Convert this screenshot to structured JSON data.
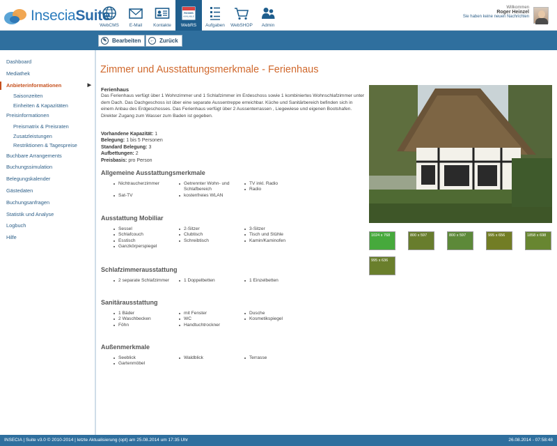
{
  "app": {
    "logo_text_light": "Insecia",
    "logo_text_bold": "Suite"
  },
  "nav": [
    {
      "label": "WebCMS",
      "icon": "globe-icon"
    },
    {
      "label": "E-Mail",
      "icon": "envelope-icon"
    },
    {
      "label": "Kontakte",
      "icon": "contact-card-icon"
    },
    {
      "label": "WebRS",
      "icon": "rooms-available-icon",
      "active": true
    },
    {
      "label": "Aufgaben",
      "icon": "tasks-icon"
    },
    {
      "label": "WebSHOP",
      "icon": "shopping-cart-icon"
    },
    {
      "label": "Admin",
      "icon": "users-icon"
    }
  ],
  "user": {
    "welcome": "Willkommen",
    "name": "Roger Heinzel",
    "messages": "Sie haben keine neuen Nachrichten"
  },
  "toolbar": {
    "edit_label": "Bearbeiten",
    "back_label": "Zurück"
  },
  "sidebar": [
    {
      "label": "Dashboard"
    },
    {
      "label": "Mediathek"
    },
    {
      "label": "Anbieterinformationen",
      "active": true,
      "arrow": "▶"
    },
    {
      "label": "Saisonzeiten",
      "sub": true
    },
    {
      "label": "Einheiten & Kapazitäten",
      "sub": true
    },
    {
      "label": "Preisinformationen"
    },
    {
      "label": "Preismatrix & Preisraten",
      "sub": true
    },
    {
      "label": "Zusatzleistungen",
      "sub": true
    },
    {
      "label": "Restriktionen & Tagespreise",
      "sub": true
    },
    {
      "label": "Buchbare Arrangements"
    },
    {
      "label": "Buchungssimulation"
    },
    {
      "label": "Belegungskalender"
    },
    {
      "label": "Gästedaten"
    },
    {
      "label": "Buchungsanfragen"
    },
    {
      "label": "Statistik und Analyse"
    },
    {
      "label": "Logbuch"
    },
    {
      "label": "Hilfe"
    }
  ],
  "main": {
    "title": "Zimmer und Ausstattungsmerkmale - Ferienhaus",
    "heading": "Ferienhaus",
    "description": "Das Ferienhaus verfügt über 1 Wohnzimmer und 1 Schlafzimmer im Erdeschoss sowie 1 kombiniertes Wohnschlafzimmer unter dem Dach. Das Dachgeschoss ist über eine separate Aussentreppe erreichbar. Küche und Sanitärbereich befinden sich in einem Anbau des Erdgeschosses. Das Ferienhaus verfügt über 2 Aussenterrassen , Liegewiese und eigenen Bootshafen. Direkter Zugang zum Wasser zum Baden ist gegeben.",
    "facts": [
      {
        "label": "Vorhandene Kapazität:",
        "value": "1"
      },
      {
        "label": "Belegung:",
        "value": "1 bis 5 Personen"
      },
      {
        "label": "Standard Belegung:",
        "value": "3"
      },
      {
        "label": "Aufbettungen:",
        "value": "2"
      },
      {
        "label": "Preisbasis:",
        "value": "pro Person"
      }
    ],
    "sections": [
      {
        "title": "Allgemeine Ausstattungsmerkmale",
        "items": [
          "Nichtraucherzimmer",
          "Getrennter Wohn- und Schlafbereich",
          "TV inkl. Radio",
          "",
          "",
          "Radio",
          "Sat-TV",
          "kostenfreies WLAN",
          ""
        ]
      },
      {
        "title": "Ausstattung Mobiliar",
        "items": [
          "Sessel",
          "2-Sitzer",
          "3-Sitzer",
          "Schlafcouch",
          "Clubtisch",
          "Tisch und Stühle",
          "Esstisch",
          "Schreibtisch",
          "Kamin/Kaminofen",
          "Ganzkörperspiegel",
          "",
          ""
        ]
      },
      {
        "title": "Schlafzimmerausstattung",
        "items": [
          "2 separate Schlafzimmer",
          "1 Doppelbetten",
          "1 Einzelbetten"
        ]
      },
      {
        "title": "Sanitärausstattung",
        "items": [
          "1 Bäder",
          "mit Fenster",
          "Dusche",
          "2 Waschbecken",
          "WC",
          "Kosmetikspiegel",
          "Föhn",
          "Handtuchtrockner",
          ""
        ]
      },
      {
        "title": "Außenmerkmale",
        "items": [
          "Seeblick",
          "Waldblick",
          "Terrasse",
          "Gartenmöbel",
          "",
          ""
        ]
      }
    ],
    "thumbnails": [
      {
        "dims": "1024 x 768"
      },
      {
        "dims": "800 x 597"
      },
      {
        "dims": "800 x 597"
      },
      {
        "dims": "995 x 656"
      },
      {
        "dims": "1858 x 698"
      },
      {
        "dims": "995 x 636"
      }
    ]
  },
  "footer": {
    "left": "INSECIA | Suite v3.0 © 2010-2014 | letzte Aktualisierung (opt) am 25.08.2014 um 17:35 Uhr",
    "right": "26.08.2014 - 07:58:48"
  },
  "colors": {
    "accent_blue": "#2f6f9e",
    "title_orange": "#d0682c",
    "active_orange": "#c6501d",
    "link_blue": "#2d5f88"
  }
}
